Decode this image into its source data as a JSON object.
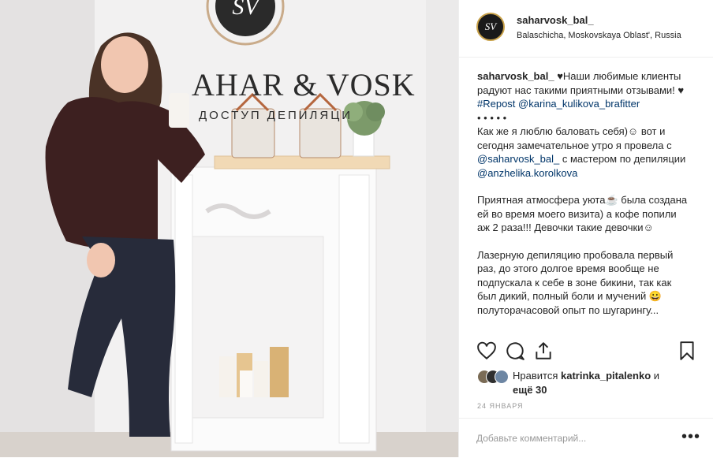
{
  "photo": {
    "wall_brand": "AHAR & VOSK",
    "wall_sub": "ДОСТУП    ДЕПИЛЯЦИ",
    "logo_monogram": "SV"
  },
  "post": {
    "username": "saharvosk_bal_",
    "location": "Balaschicha, Moskovskaya Oblast', Russia"
  },
  "caption": {
    "line1_user": "saharvosk_bal_",
    "line1_text": " ♥Наши любимые клиенты радуют нас такими приятными отзывами! ♥ ",
    "repost_tag": "#Repost",
    "repost_user": "@karina_kulikova_brafitter",
    "dots": "• • • • •",
    "para1_a": "Как же я люблю баловать себя)☺ вот и сегодня замечательное утро я провела с ",
    "para1_user1": "@saharvosk_bal_",
    "para1_b": " с мастером по депиляции ",
    "para1_user2": "@anzhelika.korolkova",
    "para2": "Приятная атмосфера уюта☕ была создана ей во время моего визита) а кофе попили аж 2 раза!!! Девочки такие девочки☺",
    "para3": "Лазерную депиляцию пробовала первый раз, до этого долгое время вообще не подпускала к себе в зоне бикини, так как был дикий, полный боли и мучений 😀 полуторачасовой опыт по шугарингу..."
  },
  "actions": {
    "like": "heart-icon",
    "comment": "comment-icon",
    "share": "share-icon",
    "save": "bookmark-icon"
  },
  "likes": {
    "prefix": "Нравится ",
    "user": "katrinka_pitalenko",
    "suffix": " и ",
    "others": "ещё 30"
  },
  "date": "24 ЯНВАРЯ",
  "add_comment": {
    "placeholder": "Добавьте комментарий...",
    "more": "•••"
  },
  "colors": {
    "link": "#003569",
    "muted": "#999999",
    "border": "#efefef",
    "gold": "#c9a24a"
  }
}
